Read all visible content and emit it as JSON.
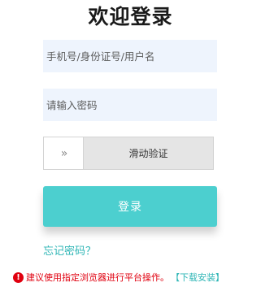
{
  "title": "欢迎登录",
  "form": {
    "username_placeholder": "手机号/身份证号/用户名",
    "username_value": "",
    "password_placeholder": "请输入密码",
    "password_value": "",
    "slider_handle_glyph": "»",
    "slider_label": "滑动验证",
    "login_label": "登录",
    "forgot_label": "忘记密码？"
  },
  "notice": {
    "icon": "exclamation-circle-icon",
    "icon_glyph": "!",
    "text": "建议使用指定浏览器进行平台操作。",
    "download_label": "【下载安装】"
  },
  "colors": {
    "accent": "#4ccfcf",
    "link": "#2fb6b6",
    "warning": "#e0000f",
    "input_bg": "#eef4fd",
    "slider_bg": "#e5e5e5"
  }
}
